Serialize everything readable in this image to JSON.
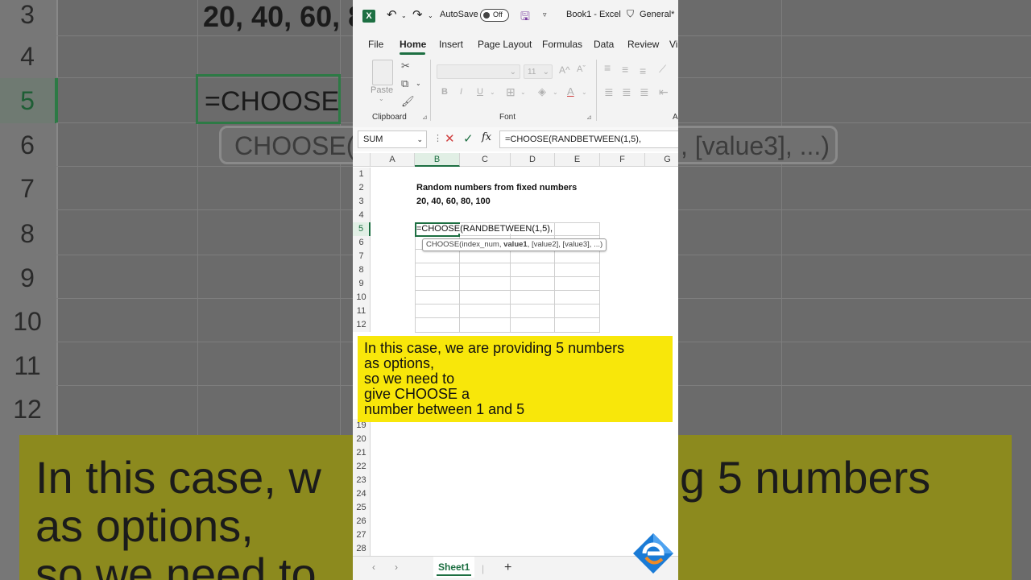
{
  "window": {
    "app_title": "Book1 - Excel",
    "autosave_label": "AutoSave",
    "autosave_state": "Off",
    "sensitivity_label": "General*"
  },
  "menu": {
    "tabs": [
      "File",
      "Home",
      "Insert",
      "Page Layout",
      "Formulas",
      "Data",
      "Review",
      "Vi"
    ],
    "active_tab": "Home"
  },
  "ribbon": {
    "paste_label": "Paste",
    "clipboard_label": "Clipboard",
    "font_label": "Font",
    "font_size": "11",
    "alignment_cut": "A"
  },
  "formula_bar": {
    "name_box": "SUM",
    "fx_label": "fx",
    "formula": "=CHOOSE(RANDBETWEEN(1,5),"
  },
  "grid": {
    "columns": [
      "A",
      "B",
      "C",
      "D",
      "E",
      "F",
      "G"
    ],
    "selected_column": "B",
    "rows_top": [
      "1",
      "2",
      "3",
      "4",
      "5",
      "6",
      "7",
      "8",
      "9",
      "10",
      "11",
      "12"
    ],
    "rows_bottom": [
      "19",
      "20",
      "21",
      "22",
      "23",
      "24",
      "25",
      "26",
      "27",
      "28"
    ],
    "selected_row": "5",
    "b2": "Random numbers from fixed numbers",
    "b3": "20, 40, 60, 80, 100",
    "b5_editing": "=CHOOSE(RANDBETWEEN(1,5),",
    "tooltip": {
      "fn": "CHOOSE(",
      "arg1": "index_num, ",
      "arg_bold": "value1",
      "rest": ", [value2], [value3], ...)"
    }
  },
  "caption": {
    "lines": [
      "In this case, we are providing 5 numbers",
      "as options,",
      "so we need to",
      "give CHOOSE a",
      "number between 1 and 5"
    ]
  },
  "sheets": {
    "active": "Sheet1",
    "add_label": "+"
  },
  "background": {
    "rows": [
      "3",
      "4",
      "5",
      "6",
      "7",
      "8",
      "9",
      "10",
      "11",
      "12"
    ],
    "selected_row": "5",
    "b3": "20, 40, 60, 8",
    "b5": "=CHOOSE(R",
    "tooltip": "CHOOSE(i",
    "tooltip_tail": ", [value3], ...)",
    "caption_lines": [
      "In this case, w",
      "g 5 numbers",
      "as options,",
      "so we need to"
    ]
  },
  "colors": {
    "excel_green": "#1d6f42",
    "caption_yellow": "#f8e70a",
    "logo_blue": "#1a7bd6",
    "logo_orange": "#f08a24"
  }
}
